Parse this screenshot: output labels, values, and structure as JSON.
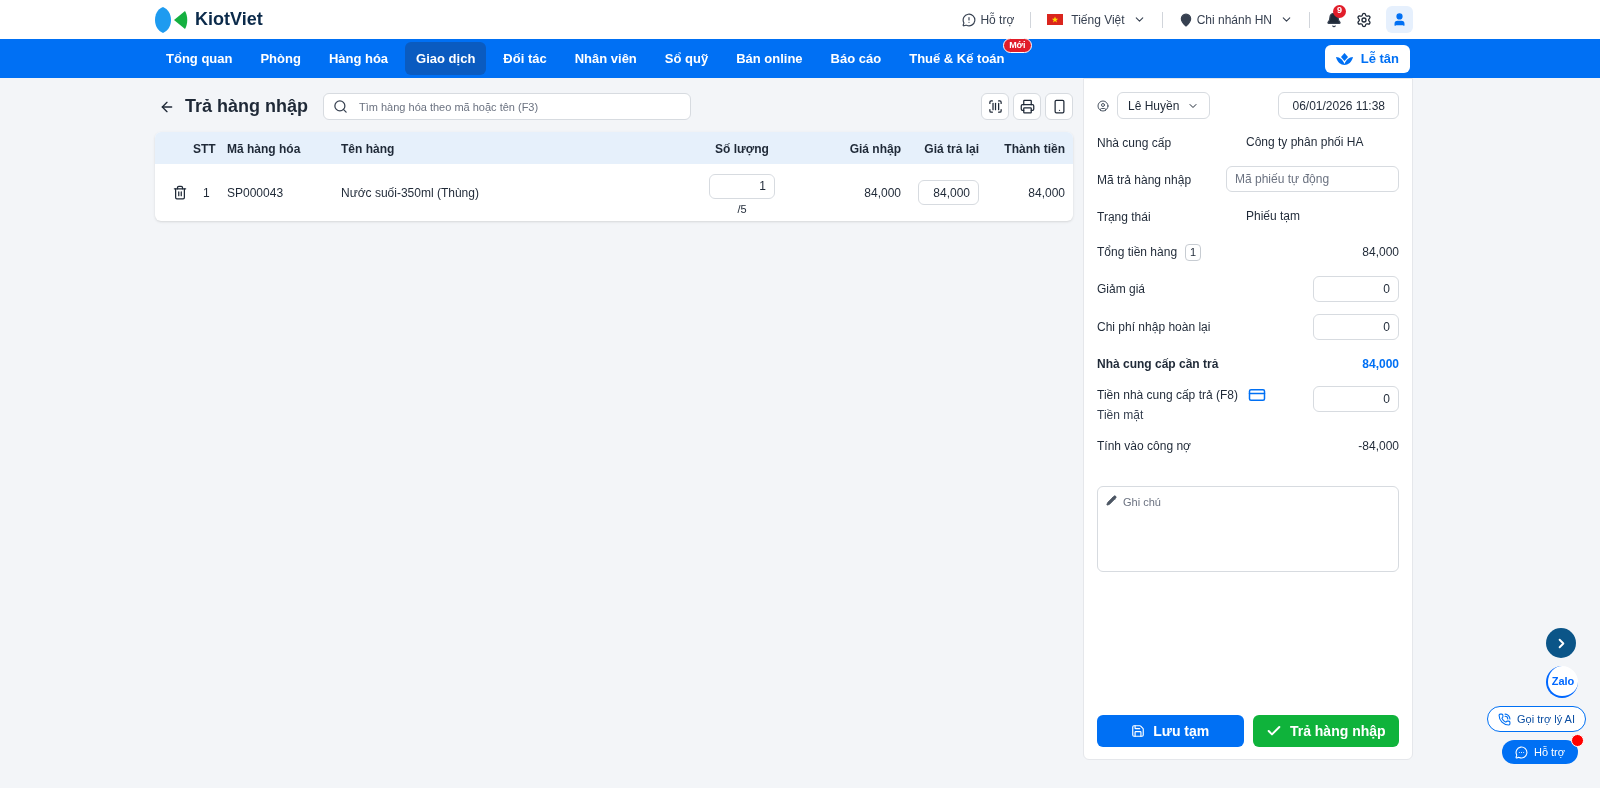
{
  "header": {
    "logo": "KiotViet",
    "support": "Hỗ trợ",
    "language": "Tiếng Việt",
    "branch": "Chi nhánh HN",
    "notification_count": "9"
  },
  "nav": {
    "items": [
      {
        "label": "Tổng quan",
        "selected": false
      },
      {
        "label": "Phòng",
        "selected": false
      },
      {
        "label": "Hàng hóa",
        "selected": false
      },
      {
        "label": "Giao dịch",
        "selected": true
      },
      {
        "label": "Đối tác",
        "selected": false
      },
      {
        "label": "Nhân viên",
        "selected": false
      },
      {
        "label": "Sổ quỹ",
        "selected": false
      },
      {
        "label": "Bán online",
        "selected": false
      },
      {
        "label": "Báo cáo",
        "selected": false
      },
      {
        "label": "Thuế & Kế toán",
        "selected": false,
        "badge": "Mới"
      }
    ],
    "reception_button": "Lễ tân"
  },
  "page": {
    "title": "Trả hàng nhập",
    "search_placeholder": "Tìm hàng hóa theo mã hoặc tên (F3)"
  },
  "table": {
    "columns": [
      "STT",
      "Mã hàng hóa",
      "Tên hàng",
      "Số lượng",
      "Giá nhập",
      "Giá trả lại",
      "Thành tiền"
    ],
    "rows": [
      {
        "stt": "1",
        "code": "SP000043",
        "name": "Nước suối-350ml (Thùng)",
        "quantity": "1",
        "quantity_max": "/5",
        "cost": "84,000",
        "return_price": "84,000",
        "total": "84,000"
      }
    ]
  },
  "panel": {
    "staff": "Lê Huyền",
    "date": "06/01/2026 11:38",
    "fields": [
      {
        "kind": "text",
        "label": "Nhà cung cấp",
        "value": "Công ty phân phối HA"
      },
      {
        "kind": "wide_input",
        "label": "Mã trả hàng nhập",
        "placeholder": "Mã phiếu tự động"
      },
      {
        "kind": "text",
        "label": "Trạng thái",
        "value": "Phiếu tạm"
      },
      {
        "kind": "amount",
        "label": "Tổng tiền hàng",
        "badge": "1",
        "value": "84,000"
      },
      {
        "kind": "input",
        "label": "Giảm giá",
        "value": "0"
      },
      {
        "kind": "input",
        "label": "Chi phí nhập hoàn lại",
        "value": "0"
      },
      {
        "kind": "total",
        "label": "Nhà cung cấp cần trả",
        "value": "84,000"
      },
      {
        "kind": "payment",
        "label": "Tiền nhà cung cấp trả (F8)",
        "sublabel": "Tiền mặt",
        "value": "0"
      },
      {
        "kind": "amount",
        "label": "Tính vào công nợ",
        "value": "-84,000"
      }
    ],
    "note_placeholder": "Ghi chú",
    "save_button": "Lưu tạm",
    "submit_button": "Trả hàng nhập"
  },
  "floating": {
    "zalo": "Zalo",
    "ai_button": "Gọi trợ lý AI",
    "support_button": "Hỗ trợ"
  }
}
